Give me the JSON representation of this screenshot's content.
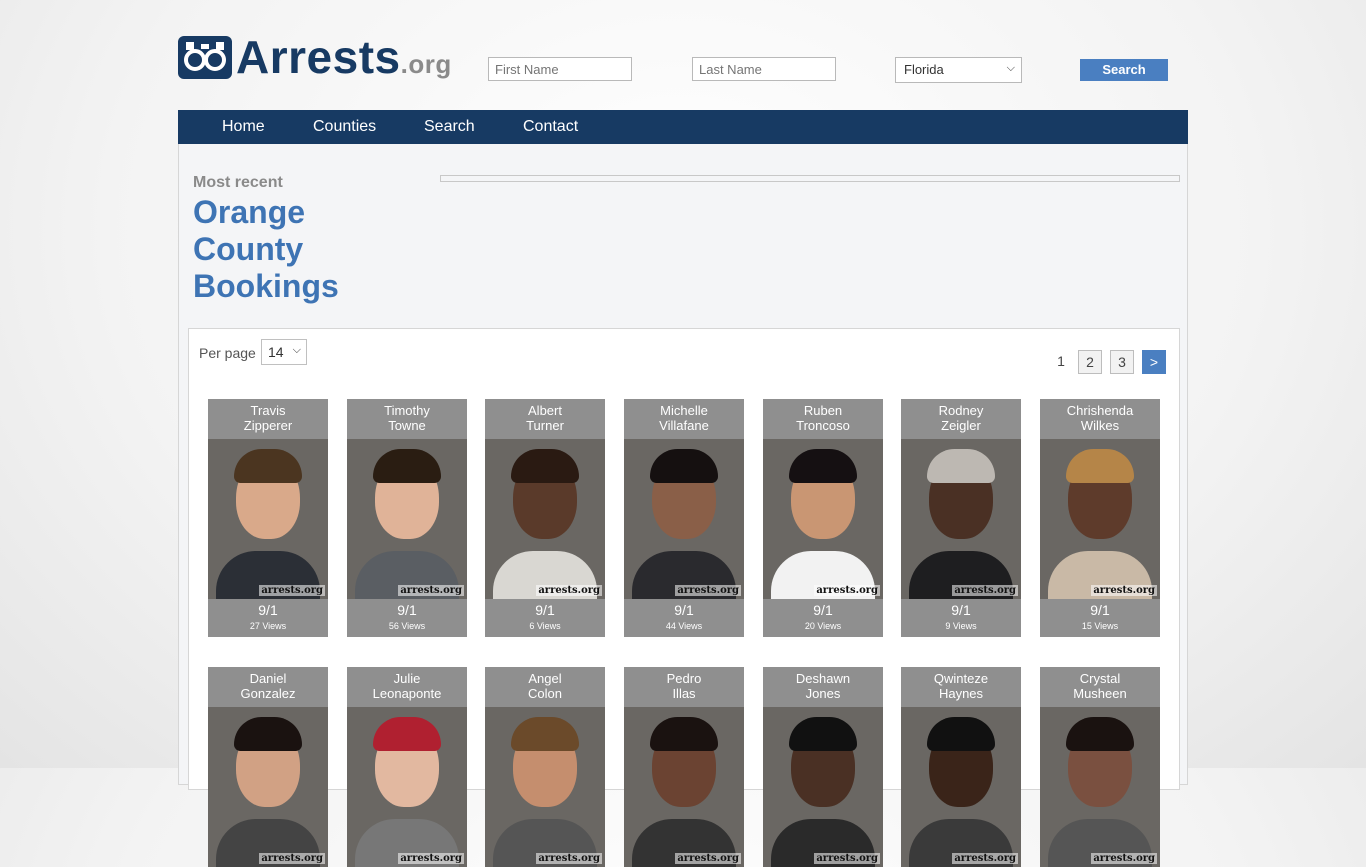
{
  "logo": {
    "brand": "Arrests",
    "tld": ".org"
  },
  "search": {
    "first_placeholder": "First Name",
    "last_placeholder": "Last Name",
    "state_selected": "Florida",
    "button": "Search"
  },
  "nav": [
    "Home",
    "Counties",
    "Search",
    "Contact"
  ],
  "heading": {
    "kicker": "Most recent",
    "title_lines": [
      "Orange",
      "County",
      "Bookings"
    ]
  },
  "perpage": {
    "label": "Per page",
    "value": "14"
  },
  "pagination": {
    "current": "1",
    "pages": [
      "2",
      "3"
    ],
    "next": ">"
  },
  "watermark": "arrests.org",
  "bookings": [
    {
      "first": "Travis",
      "last": "Zipperer",
      "date": "9/1",
      "views": "27 Views"
    },
    {
      "first": "Timothy",
      "last": "Towne",
      "date": "9/1",
      "views": "56 Views"
    },
    {
      "first": "Albert",
      "last": "Turner",
      "date": "9/1",
      "views": "6 Views"
    },
    {
      "first": "Michelle",
      "last": "Villafane",
      "date": "9/1",
      "views": "44 Views"
    },
    {
      "first": "Ruben",
      "last": "Troncoso",
      "date": "9/1",
      "views": "20 Views"
    },
    {
      "first": "Rodney",
      "last": "Zeigler",
      "date": "9/1",
      "views": "9 Views"
    },
    {
      "first": "Chrishenda",
      "last": "Wilkes",
      "date": "9/1",
      "views": "15 Views"
    },
    {
      "first": "Daniel",
      "last": "Gonzalez",
      "date": "",
      "views": ""
    },
    {
      "first": "Julie",
      "last": "Leonaponte",
      "date": "",
      "views": ""
    },
    {
      "first": "Angel",
      "last": "Colon",
      "date": "",
      "views": ""
    },
    {
      "first": "Pedro",
      "last": "Illas",
      "date": "",
      "views": ""
    },
    {
      "first": "Deshawn",
      "last": "Jones",
      "date": "",
      "views": ""
    },
    {
      "first": "Qwinteze",
      "last": "Haynes",
      "date": "",
      "views": ""
    },
    {
      "first": "Crystal",
      "last": "Musheen",
      "date": "",
      "views": ""
    }
  ]
}
